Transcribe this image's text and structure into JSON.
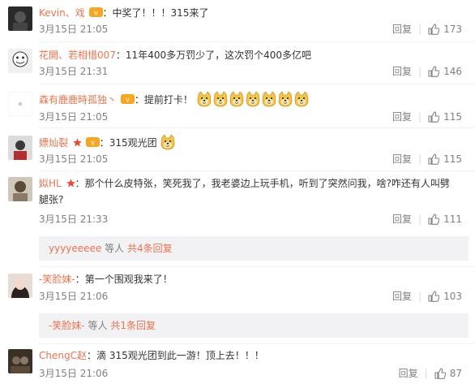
{
  "comments": [
    {
      "user": "Kevin、戏",
      "text": "中奖了！！！315来了",
      "time": "3月15日 21:05",
      "reply_label": "回复",
      "likes": "173",
      "emojis": 0
    },
    {
      "user": "花開、若相惜007",
      "text": "11年400多万罚少了，这次罚个400多亿吧",
      "time": "3月15日 21:31",
      "reply_label": "回复",
      "likes": "146",
      "emojis": 0
    },
    {
      "user": "森有鹿鹿時孤独丶",
      "text": "提前打卡！",
      "time": "3月15日 21:05",
      "reply_label": "回复",
      "likes": "115",
      "emojis": 7
    },
    {
      "user": "嫖灿裂",
      "text": "315观光团",
      "time": "3月15日 21:05",
      "reply_label": "回复",
      "likes": "115",
      "emojis": 1
    },
    {
      "user": "姒HL",
      "text": "那个什么皮特张，笑死我了，我老婆边上玩手机，听到了突然问我，啥?咋还有人叫劈腿张?",
      "time": "3月15日 21:33",
      "reply_label": "回复",
      "likes": "111",
      "emojis": 0
    },
    {
      "user": "-笑脸妹-",
      "text": "第一个围观我来了！",
      "time": "3月15日 21:06",
      "reply_label": "回复",
      "likes": "103",
      "emojis": 0
    },
    {
      "user": "ChengC赵",
      "text": "滴 315观光团到此一游！顶上去！！！",
      "time": "3月15日 21:06",
      "reply_label": "回复",
      "likes": "87",
      "emojis": 0
    }
  ],
  "subreplies": [
    {
      "name": "yyyyeeeee",
      "mid": " 等人 ",
      "count": "共4条回复"
    },
    {
      "name": "-笑脸妹-",
      "mid": " 等人 ",
      "count": "共1条回复"
    }
  ],
  "colors": {
    "username": "#eb7350",
    "meta": "#808080",
    "subreply_bg": "#f2f2f5"
  }
}
